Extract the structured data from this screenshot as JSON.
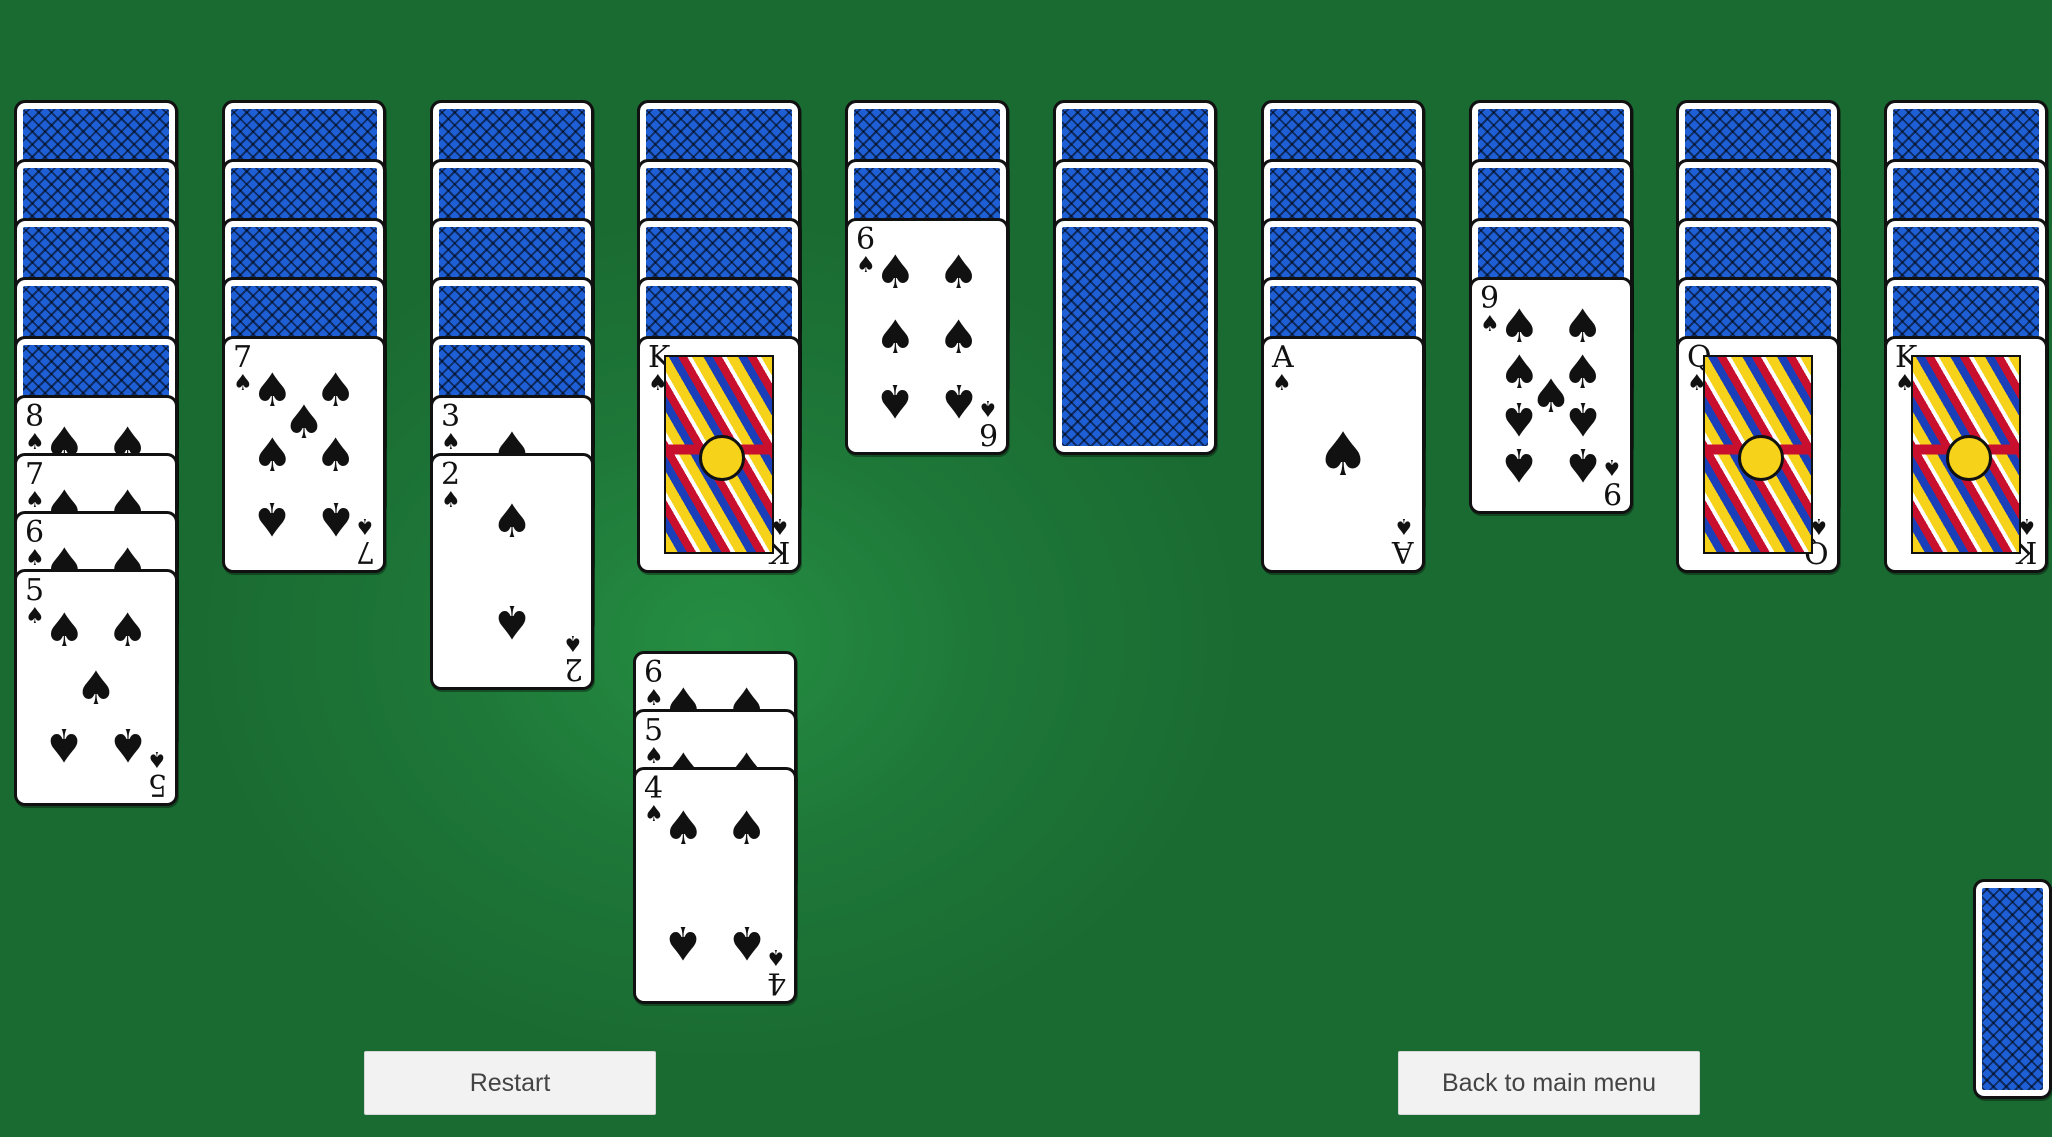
{
  "buttons": {
    "restart": "Restart",
    "back_to_main_menu": "Back to main menu"
  },
  "suit_symbol": "♠",
  "colors": {
    "felt": "#1a6b32",
    "card_back": "#1f5fd6",
    "button_bg": "#f2f2f2",
    "button_text": "#444444"
  },
  "tableau": [
    {
      "hidden": 5,
      "face_up": [
        "8",
        "7",
        "6",
        "5"
      ]
    },
    {
      "hidden": 4,
      "face_up": [
        "7"
      ]
    },
    {
      "hidden": 5,
      "face_up": [
        "3",
        "2"
      ]
    },
    {
      "hidden": 4,
      "face_up": [
        "K"
      ]
    },
    {
      "hidden": 2,
      "face_up": [
        "6"
      ]
    },
    {
      "hidden": 3,
      "face_up": []
    },
    {
      "hidden": 4,
      "face_up": [
        "A"
      ]
    },
    {
      "hidden": 3,
      "face_up": [
        "9"
      ]
    },
    {
      "hidden": 4,
      "face_up": [
        "Q"
      ]
    },
    {
      "hidden": 4,
      "face_up": [
        "K"
      ]
    }
  ],
  "dragged_stack": [
    "6",
    "5",
    "4"
  ],
  "stock": {
    "visible_cards": 1
  }
}
